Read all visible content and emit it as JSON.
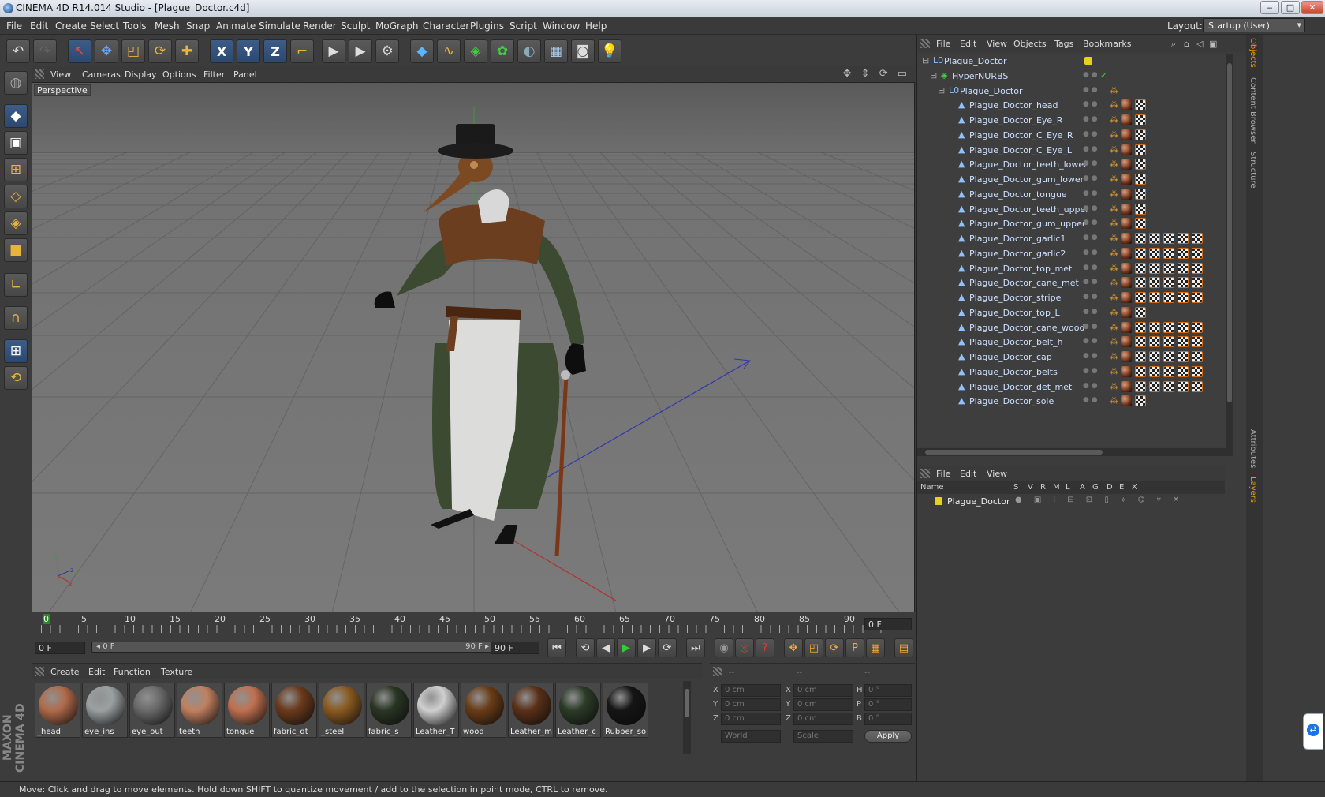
{
  "window": {
    "title": "CINEMA 4D R14.014 Studio - [Plague_Doctor.c4d]",
    "min": "‒",
    "max": "□",
    "close": "✕"
  },
  "menu": [
    "File",
    "Edit",
    "Create",
    "Select",
    "Tools",
    "Mesh",
    "Snap",
    "Animate",
    "Simulate",
    "Render",
    "Sculpt",
    "MoGraph",
    "Character",
    "Plugins",
    "Script",
    "Window",
    "Help"
  ],
  "layout": {
    "label": "Layout:",
    "value": "Startup (User)"
  },
  "toolbar": {
    "undo": "↶",
    "redo": "↷",
    "live_select": "↖",
    "move": "✥",
    "scale": "◰",
    "rotate": "⟳",
    "add": "✚",
    "axis_x": "X",
    "axis_y": "Y",
    "axis_z": "Z",
    "coord": "⌐",
    "render_view": "▶",
    "render_pv": "▶",
    "render_settings": "⚙",
    "cube": "◆",
    "spline": "∿",
    "nurbs": "◈",
    "mograph": "✿",
    "deformer": "◐",
    "scene": "▦",
    "camera": "◙",
    "light": "💡"
  },
  "left_tools": {
    "model": "◍",
    "object": "◆",
    "texture": "▣",
    "workplane": "⊞",
    "points": "◇",
    "edges": "◈",
    "polygons": "■",
    "axis": "∟",
    "magnet": "∩",
    "snap": "⊞",
    "lock": "⟲"
  },
  "viewport": {
    "menu": [
      "View",
      "Cameras",
      "Display",
      "Options",
      "Filter",
      "Panel"
    ],
    "label": "Perspective",
    "corner_icons": "✥ ⇕ ⟳ ▭"
  },
  "timeline": {
    "ticks": [
      "0",
      "5",
      "10",
      "15",
      "20",
      "25",
      "30",
      "35",
      "40",
      "45",
      "50",
      "55",
      "60",
      "65",
      "70",
      "75",
      "80",
      "85",
      "90"
    ],
    "current_frame": "0 F",
    "start": "0 F",
    "slider_start": "◂ 0 F",
    "slider_end": "90 F ▸",
    "end": "90 F"
  },
  "transport": {
    "first": "⏮",
    "prev_key": "⟲",
    "prev": "◀",
    "play": "▶",
    "next": "▶",
    "next_key": "⟳",
    "last": "⏭",
    "record": "◉",
    "autokey": "◎",
    "help": "?",
    "pos": "✥",
    "scale": "◰",
    "rot": "⟳",
    "param": "P",
    "pla": "▦",
    "film": "▤"
  },
  "materials": {
    "menu": [
      "Create",
      "Edit",
      "Function",
      "Texture"
    ],
    "items": [
      {
        "name": "_head",
        "color": "#b06a4a"
      },
      {
        "name": "eye_ins",
        "color": "#9aa0a0"
      },
      {
        "name": "eye_out",
        "color": "#6a6a6a"
      },
      {
        "name": "teeth",
        "color": "#c08060"
      },
      {
        "name": "tongue",
        "color": "#c07050"
      },
      {
        "name": "fabric_dt",
        "color": "#6a3a1c"
      },
      {
        "name": "_steel",
        "color": "#8a5a20"
      },
      {
        "name": "fabric_s",
        "color": "#2a3524"
      },
      {
        "name": "Leather_T",
        "color": "#cfcfcf"
      },
      {
        "name": "wood",
        "color": "#6a3c16"
      },
      {
        "name": "Leather_m",
        "color": "#5a3018"
      },
      {
        "name": "Leather_c",
        "color": "#2c3a28"
      },
      {
        "name": "Rubber_so",
        "color": "#151515"
      }
    ]
  },
  "coords": {
    "header": [
      "--",
      "--",
      "--"
    ],
    "labels": [
      "X",
      "Y",
      "Z",
      "X",
      "Y",
      "Z",
      "H",
      "P",
      "B"
    ],
    "values": [
      "0 cm",
      "0 cm",
      "0 cm",
      "0 cm",
      "0 cm",
      "0 cm",
      "0 °",
      "0 °",
      "0 °"
    ],
    "world": "World",
    "scale": "Scale",
    "apply": "Apply"
  },
  "objects": {
    "menu": [
      "File",
      "Edit",
      "View",
      "Objects",
      "Tags",
      "Bookmarks"
    ],
    "rows": [
      {
        "name": "Plague_Doctor",
        "level": 0,
        "icon": "L0",
        "swatches": 0
      },
      {
        "name": "HyperNURBS",
        "level": 1,
        "icon": "◈",
        "swatches": 0
      },
      {
        "name": "Plague_Doctor",
        "level": 2,
        "icon": "L0",
        "swatches": 0
      },
      {
        "name": "Plague_Doctor_head",
        "level": 3,
        "icon": "▲",
        "swatches": 2
      },
      {
        "name": "Plague_Doctor_Eye_R",
        "level": 3,
        "icon": "▲",
        "swatches": 2
      },
      {
        "name": "Plague_Doctor_C_Eye_R",
        "level": 3,
        "icon": "▲",
        "swatches": 2
      },
      {
        "name": "Plague_Doctor_C_Eye_L",
        "level": 3,
        "icon": "▲",
        "swatches": 2
      },
      {
        "name": "Plague_Doctor_teeth_lower",
        "level": 3,
        "icon": "▲",
        "swatches": 2
      },
      {
        "name": "Plague_Doctor_gum_lower",
        "level": 3,
        "icon": "▲",
        "swatches": 2
      },
      {
        "name": "Plague_Doctor_tongue",
        "level": 3,
        "icon": "▲",
        "swatches": 2
      },
      {
        "name": "Plague_Doctor_teeth_upper",
        "level": 3,
        "icon": "▲",
        "swatches": 2
      },
      {
        "name": "Plague_Doctor_gum_upper",
        "level": 3,
        "icon": "▲",
        "swatches": 2
      },
      {
        "name": "Plague_Doctor_garlic1",
        "level": 3,
        "icon": "▲",
        "swatches": 6
      },
      {
        "name": "Plague_Doctor_garlic2",
        "level": 3,
        "icon": "▲",
        "swatches": 6
      },
      {
        "name": "Plague_Doctor_top_met",
        "level": 3,
        "icon": "▲",
        "swatches": 6
      },
      {
        "name": "Plague_Doctor_cane_met",
        "level": 3,
        "icon": "▲",
        "swatches": 6
      },
      {
        "name": "Plague_Doctor_stripe",
        "level": 3,
        "icon": "▲",
        "swatches": 6
      },
      {
        "name": "Plague_Doctor_top_L",
        "level": 3,
        "icon": "▲",
        "swatches": 2
      },
      {
        "name": "Plague_Doctor_cane_wood",
        "level": 3,
        "icon": "▲",
        "swatches": 6
      },
      {
        "name": "Plague_Doctor_belt_h",
        "level": 3,
        "icon": "▲",
        "swatches": 6
      },
      {
        "name": "Plague_Doctor_cap",
        "level": 3,
        "icon": "▲",
        "swatches": 6
      },
      {
        "name": "Plague_Doctor_belts",
        "level": 3,
        "icon": "▲",
        "swatches": 6
      },
      {
        "name": "Plague_Doctor_det_met",
        "level": 3,
        "icon": "▲",
        "swatches": 6
      },
      {
        "name": "Plague_Doctor_sole",
        "level": 3,
        "icon": "▲",
        "swatches": 2
      }
    ]
  },
  "layers": {
    "menu": [
      "File",
      "Edit",
      "View"
    ],
    "columns": [
      "Name",
      "S",
      "V",
      "R",
      "M",
      "L",
      "A",
      "G",
      "D",
      "E",
      "X"
    ],
    "row": {
      "name": "Plague_Doctor",
      "color": "#e6d020"
    }
  },
  "side_tabs": [
    "Objects",
    "Content Browser",
    "Structure",
    "Attributes",
    "Layers"
  ],
  "brand": "MAXON CINEMA 4D",
  "status": "Move: Click and drag to move elements. Hold down SHIFT to quantize movement / add to the selection in point mode, CTRL to remove."
}
